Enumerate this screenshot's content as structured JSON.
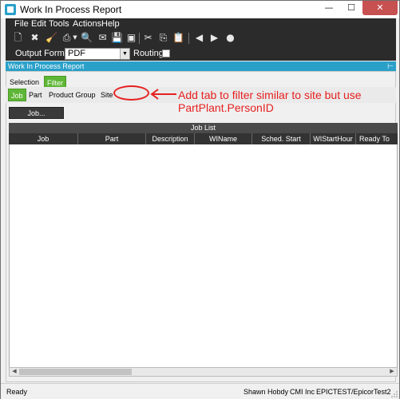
{
  "window": {
    "title": "Work In Process Report",
    "min": "—",
    "max": "☐",
    "close": "✕"
  },
  "menu": [
    {
      "label": "File"
    },
    {
      "label": "Edit"
    },
    {
      "label": "Tools"
    },
    {
      "label": "Actions"
    },
    {
      "label": "Help"
    }
  ],
  "toolbar": {
    "icons": [
      "new-icon",
      "delete-icon",
      "clear-icon",
      "print-icon",
      "print-dropdown-icon",
      "print-preview-icon",
      "email-icon",
      "save-layout-icon",
      "submit-icon",
      "cut-icon",
      "copy-icon",
      "paste-icon",
      "back-icon",
      "forward-icon",
      "stop-icon"
    ]
  },
  "options": {
    "output_format_label": "Output Format",
    "output_format_value": "PDF",
    "routing_label": "Routing"
  },
  "panel": {
    "title": "Work In Process Report"
  },
  "tabs": [
    {
      "label": "Selection"
    },
    {
      "label": "Filter"
    }
  ],
  "subtabs": [
    {
      "label": "Job"
    },
    {
      "label": "Part"
    },
    {
      "label": "Product Group"
    },
    {
      "label": "Site"
    }
  ],
  "annotation": {
    "text": "Add tab to filter similar to site but use PartPlant.PersonID",
    "color": "#e62020"
  },
  "job_button": {
    "label": "Job..."
  },
  "grid": {
    "title": "Job List",
    "columns": [
      "Job",
      "Part",
      "Description",
      "WIName",
      "Sched. Start",
      "WIStartHour",
      "Ready To"
    ]
  },
  "status": {
    "left": "Ready",
    "user": "Shawn Hobdy",
    "company": "CMI Inc",
    "server": "EPICTEST/EpicorTest2"
  },
  "colors": {
    "accent": "#2aa0c9",
    "active_tab": "#5fb636",
    "toolbar_bg": "#2b2b2b"
  }
}
